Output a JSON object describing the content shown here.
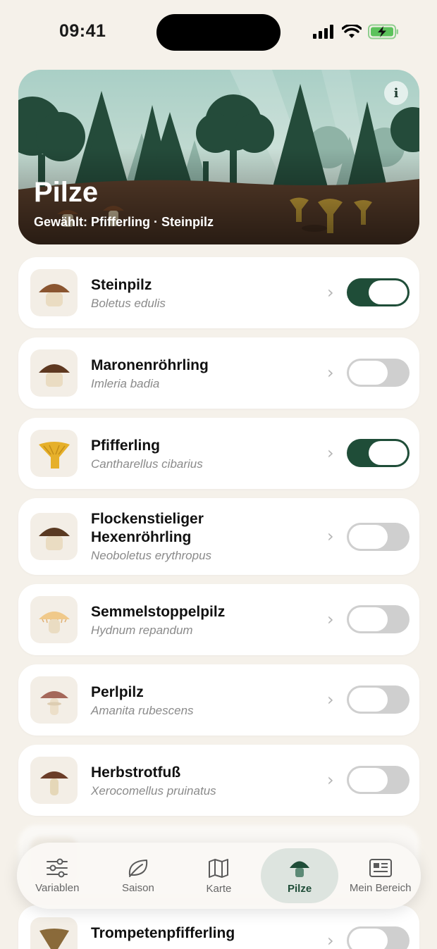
{
  "status": {
    "time": "09:41"
  },
  "hero": {
    "title": "Pilze",
    "selected_prefix": "Gewählt:",
    "selected_items": "Pfifferling · Steinpilz",
    "info_glyph": "i"
  },
  "mushrooms": [
    {
      "name": "Steinpilz",
      "latin": "Boletus edulis",
      "on": true,
      "icon": "porcini-icon"
    },
    {
      "name": "Maronenröhrling",
      "latin": "Imleria badia",
      "on": false,
      "icon": "bay-bolete-icon"
    },
    {
      "name": "Pfifferling",
      "latin": "Cantharellus cibarius",
      "on": true,
      "icon": "chanterelle-icon"
    },
    {
      "name_line1": "Flockenstieliger",
      "name_line2": "Hexenröhrling",
      "latin": "Neoboletus erythropus",
      "on": false,
      "icon": "bolete-icon"
    },
    {
      "name": "Semmelstoppelpilz",
      "latin": "Hydnum repandum",
      "on": false,
      "icon": "hedgehog-mushroom-icon"
    },
    {
      "name": "Perlpilz",
      "latin": "Amanita rubescens",
      "on": false,
      "icon": "blusher-icon"
    },
    {
      "name": "Herbstrotfuß",
      "latin": "Xerocomellus pruinatus",
      "on": false,
      "icon": "red-cracking-bolete-icon"
    },
    {
      "name": "Trompetenpfifferling",
      "on": false,
      "icon": "trumpet-chanterelle-icon"
    }
  ],
  "tabs": [
    {
      "label": "Variablen",
      "icon": "sliders-icon"
    },
    {
      "label": "Saison",
      "icon": "leaf-icon"
    },
    {
      "label": "Karte",
      "icon": "map-icon"
    },
    {
      "label": "Pilze",
      "icon": "mushroom-icon",
      "active": true
    },
    {
      "label": "Mein Bereich",
      "icon": "newspaper-icon"
    }
  ],
  "colors": {
    "accent": "#1f4d38",
    "background": "#f5f1ea",
    "toggle_off": "#cfcfcf"
  }
}
